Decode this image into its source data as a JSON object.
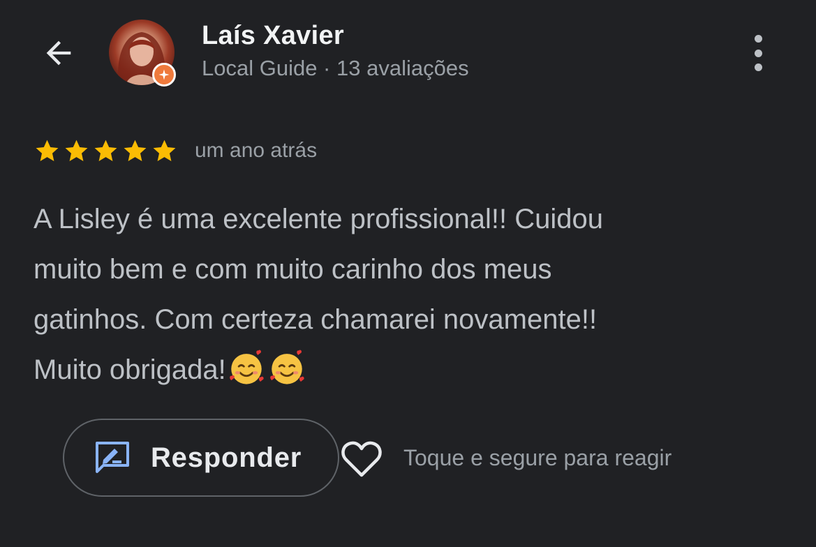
{
  "header": {
    "back_icon": "arrow-back-icon",
    "reviewer_name": "Laís Xavier",
    "reviewer_meta": "Local Guide · 13 avaliações",
    "avatar_badge_icon": "local-guide-star-badge-icon",
    "more_icon": "more-vertical-icon"
  },
  "review": {
    "rating": 5,
    "rating_max": 5,
    "date": "um ano atrás",
    "text": "A Lisley é uma excelente profissional!! Cuidou\nmuito bem e com muito carinho dos meus\ngatinhos. Com certeza chamarei novamente!!\nMuito obrigada!",
    "emojis": [
      "smiling-face-with-hearts",
      "smiling-face-with-hearts"
    ]
  },
  "actions": {
    "reply_label": "Responder",
    "reply_icon": "reply-message-icon",
    "heart_icon": "heart-outline-icon",
    "react_hint": "Toque e segure para reagir"
  },
  "colors": {
    "background": "#202124",
    "star": "#fbbc04",
    "badge": "#ef7a3c",
    "reply_icon": "#8ab4f8"
  }
}
